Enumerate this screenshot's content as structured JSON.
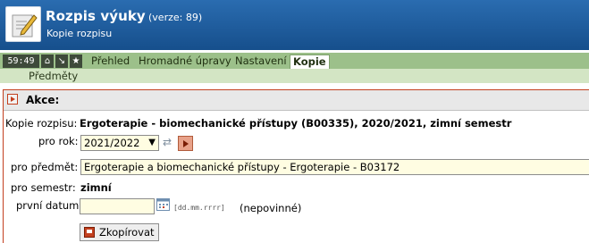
{
  "header": {
    "title": "Rozpis výuky",
    "version": "(verze: 89)",
    "subtitle": "Kopie rozpisu",
    "icon": "edit-note-icon"
  },
  "nav": {
    "clock": "59:49",
    "buttons": [
      {
        "icon": "home-icon",
        "glyph": "⌂"
      },
      {
        "icon": "arrow-down-right-icon",
        "glyph": "↘"
      },
      {
        "icon": "star-icon",
        "glyph": "★"
      }
    ],
    "tabs": [
      {
        "label": "Přehled"
      },
      {
        "label": "Hromadné úpravy"
      },
      {
        "label": "Nastavení"
      },
      {
        "label": "Kopie",
        "active": true
      }
    ],
    "subtab": "Předměty"
  },
  "panel": {
    "title": "Akce:",
    "kopie_label": "Kopie rozpisu:",
    "kopie_value": "Ergoterapie - biomechanické přístupy (B00335), 2020/2021, zimní semestr",
    "rok_label": "pro rok:",
    "rok_value": "2021/2022",
    "predmet_label": "pro předmět:",
    "predmet_value": "Ergoterapie a biomechanické přístupy - Ergoterapie - B03172",
    "semestr_label": "pro semestr:",
    "semestr_value": "zimní",
    "datum_label": "první datum:",
    "datum_value": "",
    "datum_format": "[dd.mm.rrrr]",
    "datum_optional": "(nepovinné)",
    "copy_button": "Zkopírovat"
  }
}
